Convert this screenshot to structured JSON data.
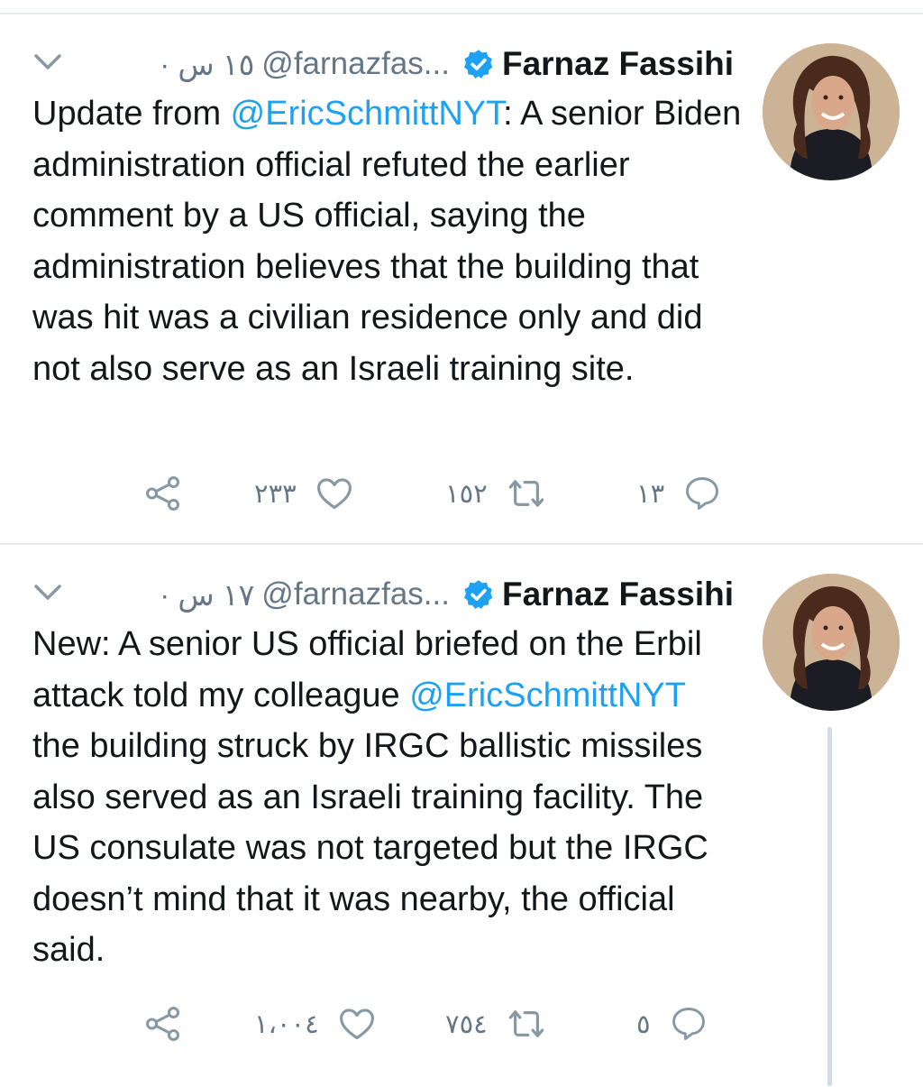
{
  "colors": {
    "link": "#1da1f2",
    "muted": "#657786",
    "text": "#14171a",
    "verified": "#1da1f2"
  },
  "tweets": [
    {
      "name": "Farnaz Fassihi",
      "handle": "@farnazfas...",
      "time": "١٥ س",
      "separator": "·",
      "parts": [
        {
          "type": "text",
          "text": "Update from "
        },
        {
          "type": "mention",
          "text": "@EricSchmittNYT"
        },
        {
          "type": "text",
          "text": ": A senior Biden administration official refuted the earlier comment by a US official, saying the administration believes that the building that was hit was a civilian residence only and did not also serve as an Israeli training site."
        }
      ],
      "replies": "١٣",
      "retweets": "١٥٢",
      "likes": "٢٣٣",
      "icons": {
        "menu": "chevron-down-icon",
        "verified": "verified-badge-icon",
        "reply": "reply-icon",
        "retweet": "retweet-icon",
        "like": "heart-icon",
        "share": "share-icon"
      }
    },
    {
      "name": "Farnaz Fassihi",
      "handle": "@farnazfas...",
      "time": "١٧ س",
      "separator": "·",
      "parts": [
        {
          "type": "text",
          "text": "New: A senior US official briefed on the Erbil attack told my colleague "
        },
        {
          "type": "mention",
          "text": "@EricSchmittNYT"
        },
        {
          "type": "text",
          "text": "  the building struck by IRGC ballistic missiles also served as an Israeli training facility. The US consulate was not targeted but the IRGC doesn’t mind that it was nearby, the official said."
        }
      ],
      "replies": "٥",
      "retweets": "٧٥٤",
      "likes": "١،٠٠٤",
      "icons": {
        "menu": "chevron-down-icon",
        "verified": "verified-badge-icon",
        "reply": "reply-icon",
        "retweet": "retweet-icon",
        "like": "heart-icon",
        "share": "share-icon"
      }
    }
  ]
}
